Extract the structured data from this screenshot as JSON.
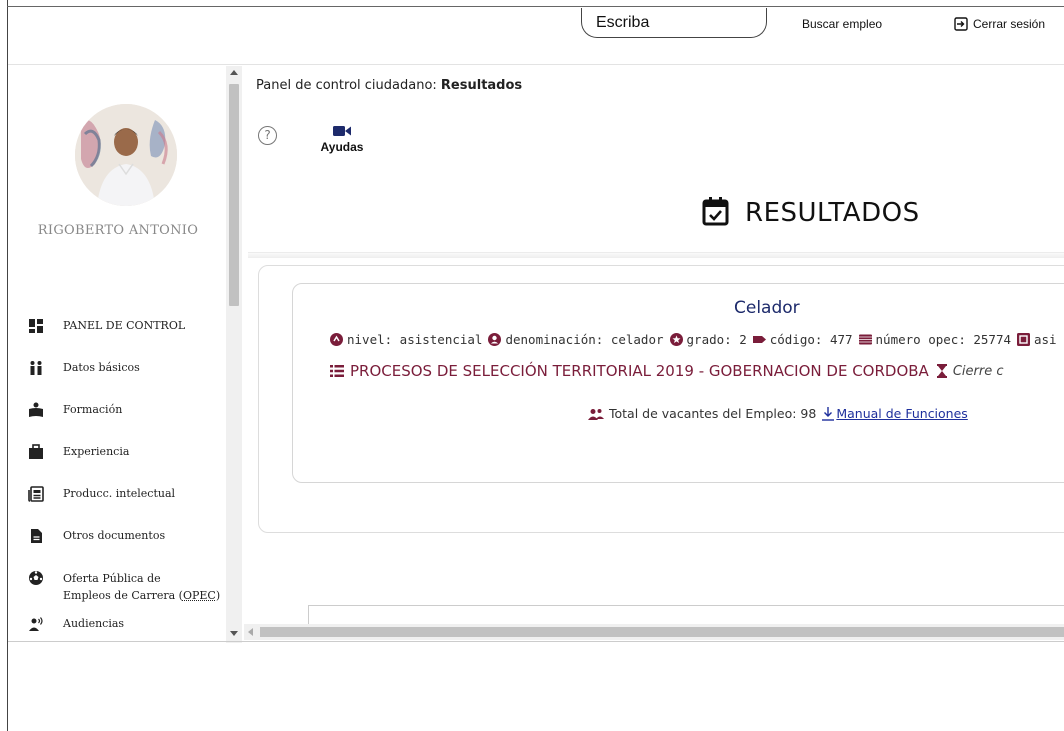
{
  "header": {
    "search_value": "Escriba",
    "buscar_label": "Buscar empleo",
    "logout_label": "Cerrar sesión"
  },
  "sidebar": {
    "user_name": "RIGOBERTO ANTONIO",
    "menu": [
      {
        "label": "PANEL DE CONTROL",
        "icon": "dashboard-icon"
      },
      {
        "label": "Datos básicos",
        "icon": "people-icon"
      },
      {
        "label": "Formación",
        "icon": "reading-person-icon"
      },
      {
        "label": "Experiencia",
        "icon": "briefcase-icon"
      },
      {
        "label": "Producc. intelectual",
        "icon": "newspaper-icon"
      },
      {
        "label": "Otros documentos",
        "icon": "document-icon"
      },
      {
        "label_line1": "Oferta Pública de",
        "label_line2_prefix": "Empleos de Carrera (",
        "label_line2_abbr": "OPEC",
        "label_line2_suffix": ")",
        "icon": "soccer-ball-icon"
      },
      {
        "label": "Audiencias",
        "icon": "speaker-icon"
      }
    ]
  },
  "main": {
    "breadcrumb_prefix": "Panel de control ciudadano: ",
    "breadcrumb_current": "Resultados",
    "help_symbol": "?",
    "ayudas_label": "Ayudas",
    "results_title": "RESULTADOS",
    "job": {
      "title": "Celador",
      "nivel": "nivel: asistencial",
      "denominacion": "denominación: celador",
      "grado": "grado: 2",
      "codigo": "código: 477",
      "opec": "número opec: 25774",
      "asig": "asi",
      "process": "PROCESOS DE SELECCIÓN TERRITORIAL 2019 - GOBERNACION DE CORDOBA",
      "cierre": "Cierre c",
      "vacantes": "Total de vacantes del Empleo: 98",
      "manual_link": "Manual de Funciones"
    }
  },
  "colors": {
    "job_title": "#1d2a6b",
    "process": "#7a1d3a",
    "link": "#1e2f9c"
  }
}
